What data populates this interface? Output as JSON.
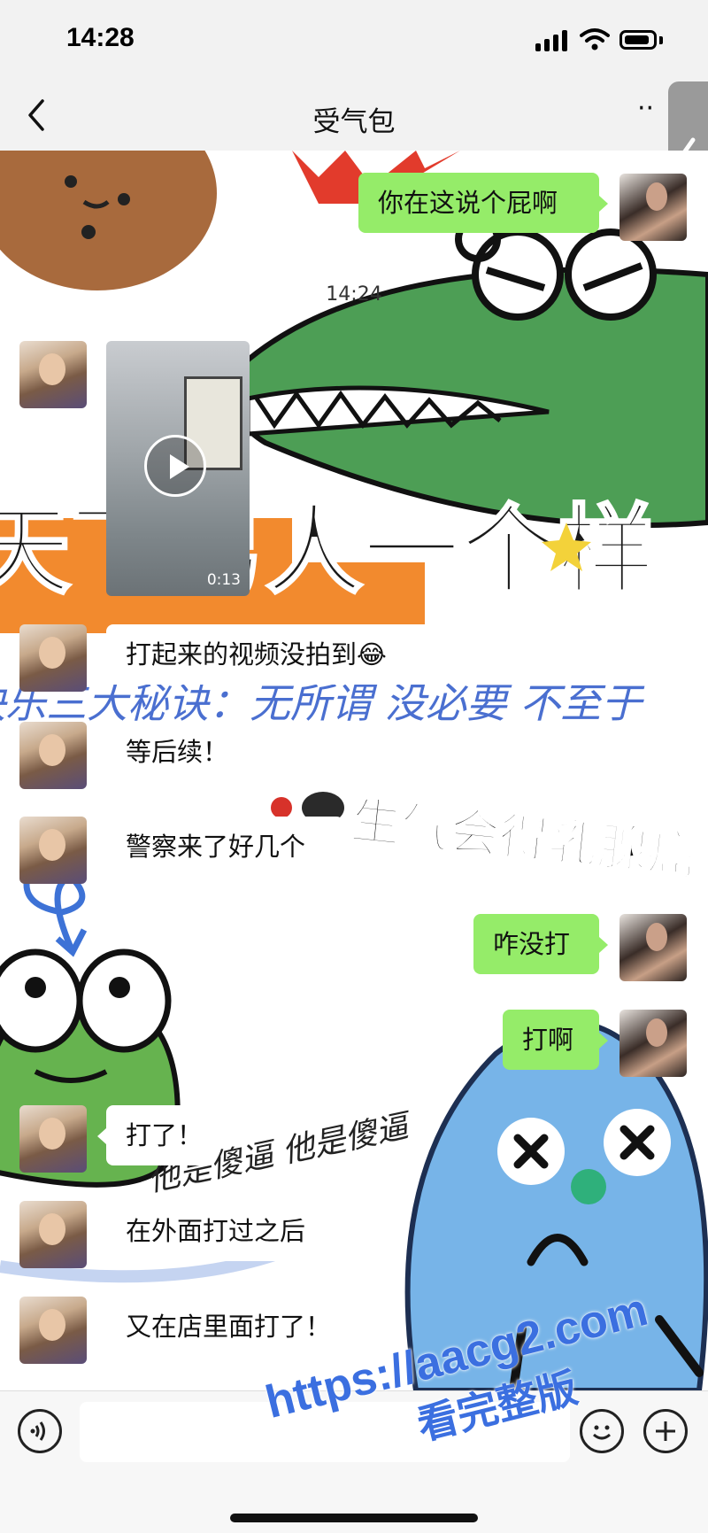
{
  "status_bar": {
    "time": "14:28"
  },
  "nav": {
    "title": "受气包",
    "back_icon": "chevron-left-icon",
    "more_icon": "more-icon"
  },
  "background_art": {
    "banner_text": "天下男人一个样",
    "script_text": "快乐三大秘诀：无所谓 没必要 不至于",
    "sticker_text": "生气会得乳腺癌",
    "note_text": "他是傻逼 他是傻逼"
  },
  "chat": {
    "timestamp": "14:24",
    "messages": [
      {
        "from": "me",
        "type": "text",
        "text": "你在这说个屁啊"
      },
      {
        "from": "friend",
        "type": "video",
        "duration": "0:13"
      },
      {
        "from": "friend",
        "type": "text",
        "text": "打起来的视频没拍到😂"
      },
      {
        "from": "friend",
        "type": "text",
        "text": "等后续！"
      },
      {
        "from": "friend",
        "type": "text",
        "text": "警察来了好几个"
      },
      {
        "from": "me",
        "type": "text",
        "text": "咋没打"
      },
      {
        "from": "me",
        "type": "text",
        "text": "打啊"
      },
      {
        "from": "friend",
        "type": "text",
        "text": "打了！"
      },
      {
        "from": "friend",
        "type": "text",
        "text": "在外面打过之后"
      },
      {
        "from": "friend",
        "type": "text",
        "text": "又在店里面打了！"
      }
    ]
  },
  "input_bar": {
    "placeholder": "",
    "voice_icon": "voice-icon",
    "emoji_icon": "emoji-icon",
    "add_icon": "plus-icon"
  },
  "watermark": {
    "line1": "https://aacg2.com",
    "line2": "看完整版"
  },
  "colors": {
    "my_bubble": "#95ec69",
    "friend_bubble": "#ffffff",
    "chat_bg": "#ffffff"
  }
}
